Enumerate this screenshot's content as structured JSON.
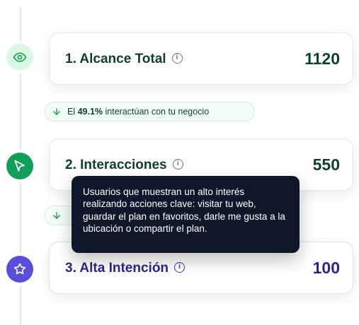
{
  "timeline": {
    "nodes": [
      {
        "icon": "eye-icon",
        "color": "#16a34a"
      },
      {
        "icon": "cursor-arrow-icon",
        "color": "#ffffff"
      },
      {
        "icon": "star-icon",
        "color": "#ffffff"
      }
    ]
  },
  "cards": [
    {
      "title": "1. Alcance Total",
      "value": "1120"
    },
    {
      "title": "2. Interacciones",
      "value": "550"
    },
    {
      "title": "3. Alta Intención",
      "value": "100"
    }
  ],
  "pills": [
    {
      "prefix": "El ",
      "percent": "49.1%",
      "suffix": " interactúan con tu negocio"
    }
  ],
  "tooltip": {
    "text": "Usuarios que muestran un alto interés realizando acciones clave: visitar tu web, guardar el plan en favoritos, darle me gusta a la ubicación o compartir el plan."
  }
}
